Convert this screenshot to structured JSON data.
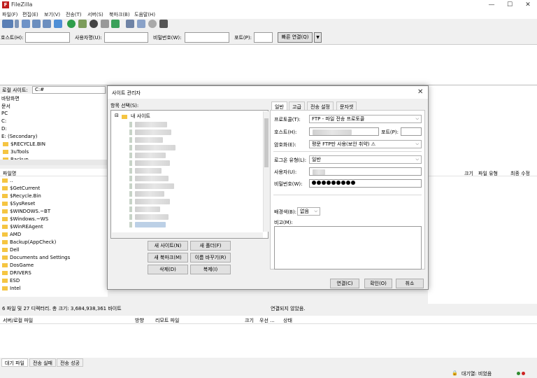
{
  "window": {
    "title": "FileZilla",
    "icon_letter": "F"
  },
  "menu": [
    "파일(F)",
    "편집(E)",
    "보기(V)",
    "전송(T)",
    "서버(S)",
    "북마크(B)",
    "도움말(H)"
  ],
  "quickconnect": {
    "host_label": "호스트(H):",
    "user_label": "사용자명(U):",
    "pass_label": "비밀번호(W):",
    "port_label": "포트(P):",
    "connect_label": "빠른 연결(Q)",
    "dropdown_arrow": "▼"
  },
  "local_site": {
    "label": "로컬 사이트:",
    "path": "C:#",
    "tree": [
      "내 PC",
      "C:",
      "D:",
      "E: (Secondary)",
      "$RECYCLE.BIN",
      "3uTools",
      "Backup"
    ],
    "tree_prefixes": [
      "바탕화면",
      "문서",
      "PC"
    ]
  },
  "local_list": {
    "col_name": "파일명",
    "rows": [
      "..",
      "$GetCurrent",
      "$Recycle.Bin",
      "$SysReset",
      "$WINDOWS.~BT",
      "$Windows.~WS",
      "$WinREAgent",
      "AMD",
      "Backup(AppCheck)",
      "Dell",
      "Documents and Settings",
      "DosGame",
      "DRIVERS",
      "ESD",
      "Intel"
    ]
  },
  "remote_list": {
    "col_size": "크기",
    "col_type": "파일 유형",
    "col_modified": "최종 수정"
  },
  "status": {
    "local": "6 파일 및 27 디렉터리. 총 크기: 3,684,938,361 바이트",
    "remote": "연결되지 않았음."
  },
  "queue": {
    "cols": [
      "서버/로컬 파일",
      "방향",
      "리모트 파일",
      "크기",
      "우선 ...",
      "상태"
    ],
    "tabs": [
      "대기 파일",
      "전송 실패",
      "전송 성공"
    ],
    "queue_status": "대기열: 비었음"
  },
  "dialog": {
    "title": "사이트 관리자",
    "close": "✕",
    "entries_label": "항목 선택(S):",
    "root_node": "내 사이트",
    "buttons": {
      "new_site": "새 사이트(N)",
      "new_folder": "새 폴더(F)",
      "new_bookmark": "새 북마크(M)",
      "rename": "이름 바꾸기(R)",
      "delete": "삭제(D)",
      "duplicate": "복제(I)",
      "connect": "연결(C)",
      "ok": "확인(O)",
      "cancel": "취소"
    },
    "tabs": [
      "일반",
      "고급",
      "전송 설정",
      "문자셋"
    ],
    "general": {
      "protocol_label": "프로토콜(T):",
      "protocol_value": "FTP - 파일 전송 프로토콜",
      "host_label": "호스트(H):",
      "port_label": "포트(P):",
      "encryption_label": "암호화(E):",
      "encryption_value": "평문 FTP만 사용(보안 취약) ⚠",
      "logon_label": "로그온 유형(L):",
      "logon_value": "일반",
      "user_label": "사용자(U):",
      "password_label": "비밀번호(W):",
      "password_dots": 9,
      "bgcolor_label": "배경색(B):",
      "bgcolor_value": "없음",
      "comments_label": "비고(M):"
    }
  }
}
